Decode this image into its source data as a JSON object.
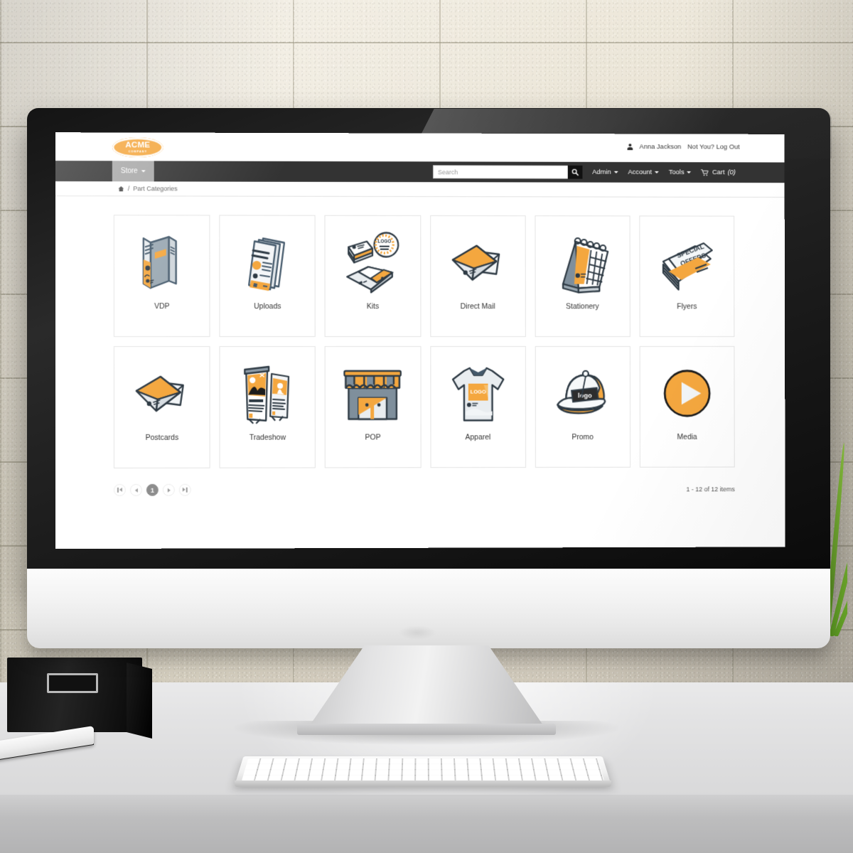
{
  "scene": {
    "device": "desktop-monitor",
    "wall_color": "#e6e0d1",
    "desk_color": "#e2e2e3"
  },
  "brand": {
    "accent": "#f4a73f",
    "navbar_color": "#333333",
    "logo_main": "ACME",
    "logo_sub": "COMPANY"
  },
  "header": {
    "user_name": "Anna Jackson",
    "logout_text": "Not You? Log Out"
  },
  "navbar": {
    "store_label": "Store",
    "search_placeholder": "Search",
    "search_value": "",
    "items": [
      {
        "label": "Admin",
        "has_caret": true
      },
      {
        "label": "Account",
        "has_caret": true
      },
      {
        "label": "Tools",
        "has_caret": true
      }
    ],
    "cart_label": "Cart",
    "cart_count": "(0)"
  },
  "breadcrumb": {
    "home_icon": "home-icon",
    "separator": "/",
    "current": "Part Categories"
  },
  "categories": [
    {
      "label": "VDP",
      "icon": "brochure-icon"
    },
    {
      "label": "Uploads",
      "icon": "documents-stack-icon"
    },
    {
      "label": "Kits",
      "icon": "kit-pack-icon"
    },
    {
      "label": "Direct Mail",
      "icon": "envelopes-icon"
    },
    {
      "label": "Stationery",
      "icon": "desk-calendar-icon"
    },
    {
      "label": "Flyers",
      "icon": "flyer-stack-icon"
    },
    {
      "label": "Postcards",
      "icon": "envelopes-icon"
    },
    {
      "label": "Tradeshow",
      "icon": "banner-stands-icon"
    },
    {
      "label": "POP",
      "icon": "storefront-awning-icon"
    },
    {
      "label": "Apparel",
      "icon": "tshirt-icon"
    },
    {
      "label": "Promo",
      "icon": "cap-icon"
    },
    {
      "label": "Media",
      "icon": "play-circle-icon"
    }
  ],
  "artwork_text": {
    "flyers_line1": "SPECIAL",
    "flyers_line2": "OFFERS",
    "sticker_logo": "LOGO",
    "shirt_logo": "LOGO",
    "cap_logo": "logo"
  },
  "pagination": {
    "first": "first-page-button",
    "prev": "previous-page-button",
    "current_page": "1",
    "next": "next-page-button",
    "last": "last-page-button",
    "info": "1 - 12 of 12 items"
  }
}
